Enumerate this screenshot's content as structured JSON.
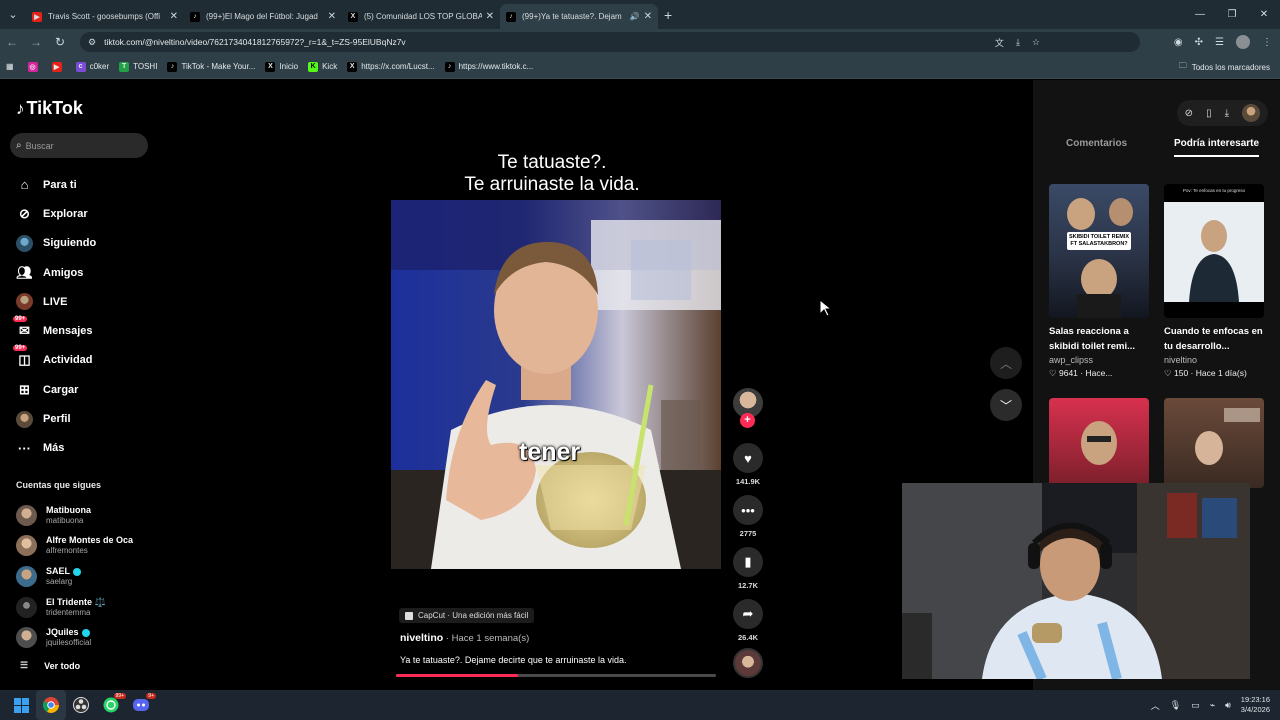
{
  "browser": {
    "tabs": [
      {
        "title": "Travis Scott - goosebumps (Offi",
        "favicon": "youtube",
        "active": false
      },
      {
        "title": "(99+)El Mago del Fútbol: Jugad",
        "favicon": "tiktok",
        "active": false
      },
      {
        "title": "(5) Comunidad LOS TOP GLOBA",
        "favicon": "x",
        "active": false
      },
      {
        "title": "(99+)Ya te tatuaste?. Dejam",
        "favicon": "tiktok",
        "active": true
      }
    ],
    "new_tab": "+",
    "url": "tiktok.com/@niveltino/video/7621734041812765972?_r=1&_t=ZS-95ElUBqNz7v",
    "bookmarks": [
      {
        "label": "",
        "icon": "instagram"
      },
      {
        "label": "",
        "icon": "youtube"
      },
      {
        "label": "c0ker",
        "icon": "c0ker"
      },
      {
        "label": "TOSHI",
        "icon": "toshi"
      },
      {
        "label": "TikTok - Make Your...",
        "icon": "tiktok"
      },
      {
        "label": "Inicio",
        "icon": "x"
      },
      {
        "label": "Kick",
        "icon": "kick"
      },
      {
        "label": "https://x.com/Lucst...",
        "icon": "x"
      },
      {
        "label": "https://www.tiktok.c...",
        "icon": "tiktok"
      }
    ],
    "all_bookmarks": "Todos los marcadores"
  },
  "tiktok": {
    "logo": "TikTok",
    "search_placeholder": "Buscar",
    "nav": [
      {
        "label": "Para ti",
        "icon": "home-icon"
      },
      {
        "label": "Explorar",
        "icon": "compass-icon"
      },
      {
        "label": "Siguiendo",
        "icon": "following-avatar-icon"
      },
      {
        "label": "Amigos",
        "icon": "friends-icon"
      },
      {
        "label": "LIVE",
        "icon": "live-avatar-icon"
      },
      {
        "label": "Mensajes",
        "icon": "messages-icon",
        "badge": "99+"
      },
      {
        "label": "Actividad",
        "icon": "activity-icon",
        "badge": "99+"
      },
      {
        "label": "Cargar",
        "icon": "upload-icon"
      },
      {
        "label": "Perfil",
        "icon": "profile-avatar-icon"
      },
      {
        "label": "Más",
        "icon": "more-icon"
      }
    ],
    "following_title": "Cuentas que sigues",
    "following": [
      {
        "name": "Matibuona",
        "handle": "matibuona",
        "color": "#6d5a4e",
        "verified": false
      },
      {
        "name": "Alfre Montes de Oca",
        "handle": "alfremontes",
        "color": "#8c6f58",
        "verified": false
      },
      {
        "name": "SAEL",
        "handle": "saelarg",
        "color": "#3d6b8c",
        "verified": true
      },
      {
        "name": "El Tridente ⚖️",
        "handle": "tridentemma",
        "color": "#222222",
        "verified": false
      },
      {
        "name": "JQuiles",
        "handle": "jquilesofficial",
        "color": "#4e4e4e",
        "verified": true
      }
    ],
    "see_more": "Ver todo"
  },
  "video": {
    "caption_line1": "Te tatuaste?.",
    "caption_line2": "Te arruinaste la vida.",
    "subtitle_word": "tener",
    "capcut_label": "CapCut · Una edición más fácil",
    "author": "niveltino",
    "time": " · Hace 1 semana(s)",
    "description": "Ya te tatuaste?. Dejame decirte que te arruinaste la vida.",
    "progress": 0.38,
    "likes": "141.9K",
    "comments": "2775",
    "saves": "12.7K",
    "shares": "26.4K"
  },
  "panel": {
    "tab_comments": "Comentarios",
    "tab_suggested": "Podría interesarte",
    "cards": [
      {
        "title": "Salas reacciona a skibidi toilet remi...",
        "author": "awp_clipss",
        "likes": "9641",
        "age": "Hace...",
        "label": "SKIBIDI TOILET REMIX FT SALASTAKBRON?"
      },
      {
        "title": "Cuando te enfocas en tu desarrollo...",
        "author": "niveltino",
        "likes": "150",
        "age": "Hace 1 día(s)",
        "top_text": "Pov: Te enfocas en tu progreso"
      }
    ]
  },
  "taskbar": {
    "whatsapp_badge": "99+",
    "discord_badge": "9+",
    "time": "19:23:16",
    "date": "3/4/2026"
  }
}
